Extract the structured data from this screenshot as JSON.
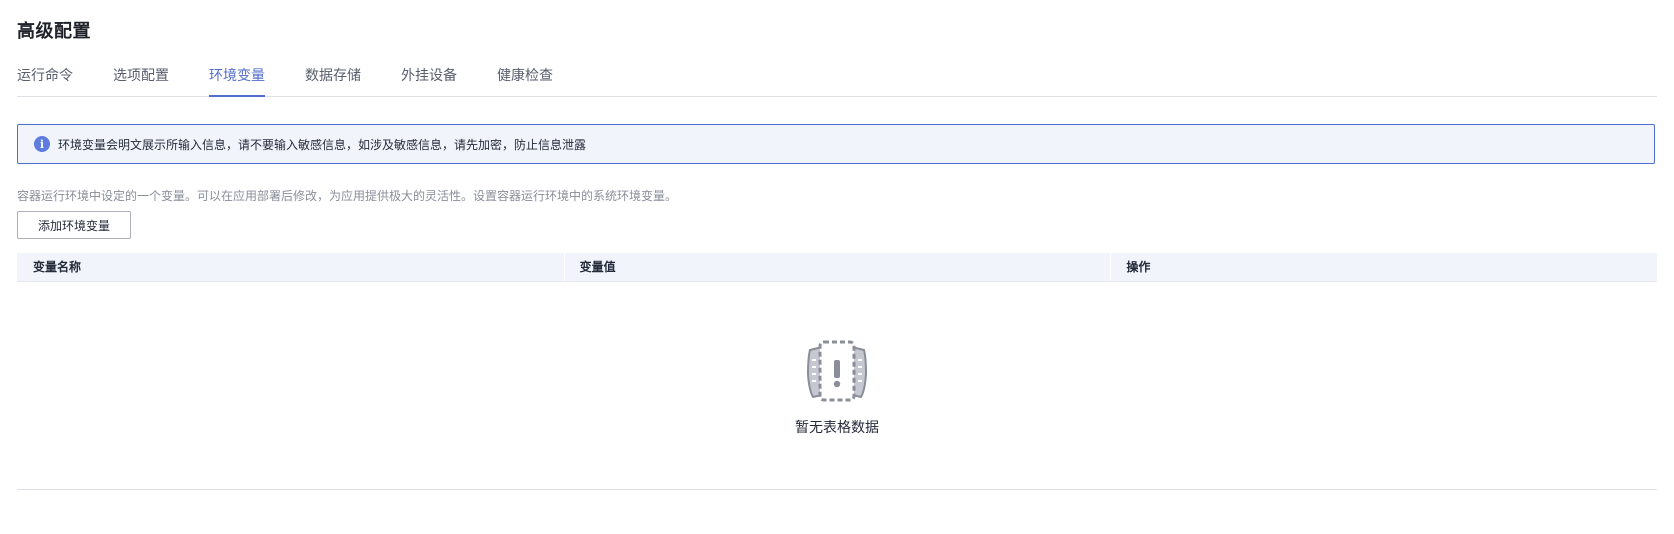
{
  "page": {
    "title": "高级配置"
  },
  "tabs": [
    {
      "label": "运行命令",
      "active": false
    },
    {
      "label": "选项配置",
      "active": false
    },
    {
      "label": "环境变量",
      "active": true
    },
    {
      "label": "数据存储",
      "active": false
    },
    {
      "label": "外挂设备",
      "active": false
    },
    {
      "label": "健康检查",
      "active": false
    }
  ],
  "notice": {
    "icon": "info-icon",
    "text": "环境变量会明文展示所输入信息，请不要输入敏感信息，如涉及敏感信息，请先加密，防止信息泄露"
  },
  "description": "容器运行环境中设定的一个变量。可以在应用部署后修改，为应用提供极大的灵活性。设置容器运行环境中的系统环境变量。",
  "add_button": {
    "label": "添加环境变量"
  },
  "table": {
    "columns": [
      "变量名称",
      "变量值",
      "操作"
    ],
    "rows": [],
    "empty_text": "暂无表格数据",
    "empty_icon": "empty-data-icon"
  },
  "colors": {
    "accent": "#526ecc",
    "notice_bg": "#f1f4fb",
    "header_bg": "#f1f4fb",
    "text_primary": "#252b3a",
    "text_secondary": "#8a8e99"
  }
}
